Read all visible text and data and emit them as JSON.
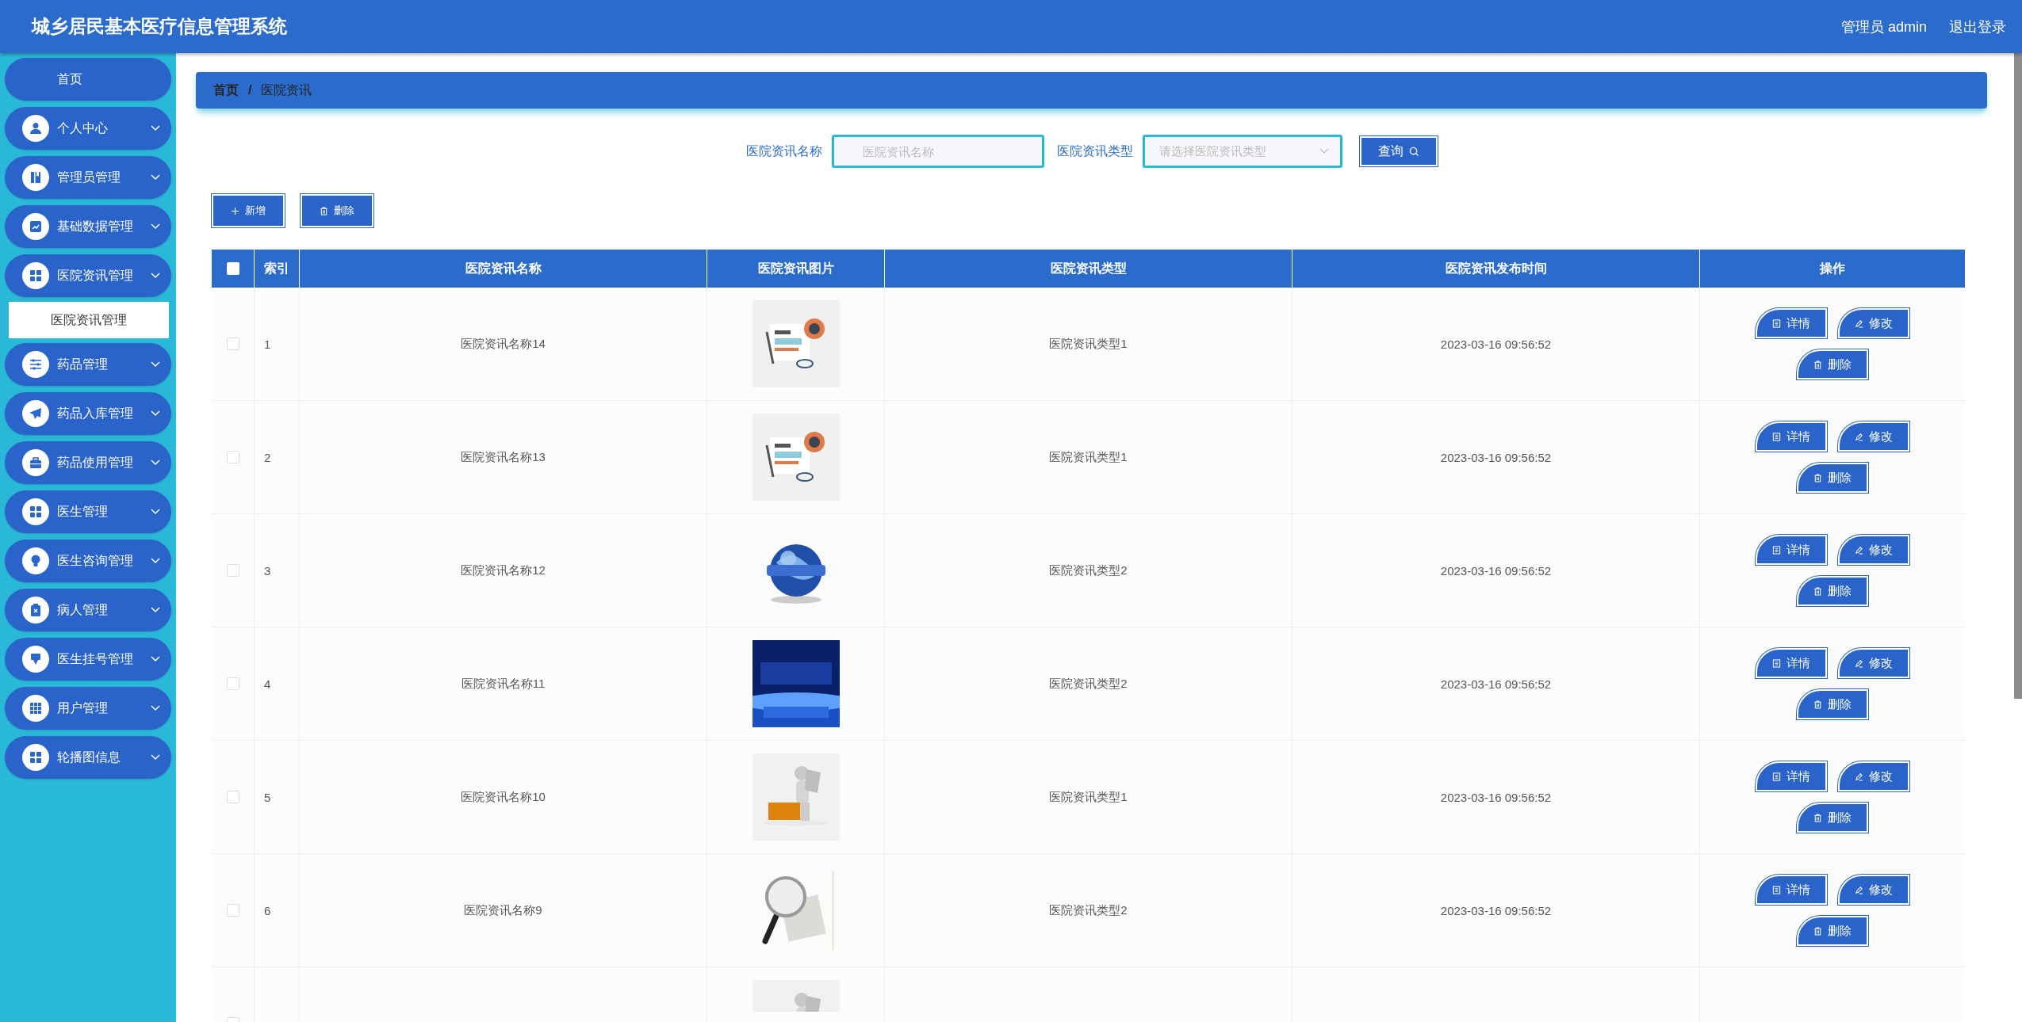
{
  "header": {
    "title": "城乡居民基本医疗信息管理系统",
    "user": "管理员 admin",
    "logout": "退出登录"
  },
  "sidebar": {
    "items": [
      {
        "kind": "link",
        "label": "首页"
      },
      {
        "kind": "menu",
        "label": "个人中心"
      },
      {
        "kind": "menu",
        "label": "管理员管理"
      },
      {
        "kind": "menu",
        "label": "基础数据管理"
      },
      {
        "kind": "menu",
        "label": "医院资讯管理",
        "children": [
          {
            "label": "医院资讯管理",
            "selected": true
          }
        ]
      },
      {
        "kind": "menu",
        "label": "药品管理"
      },
      {
        "kind": "menu",
        "label": "药品入库管理"
      },
      {
        "kind": "menu",
        "label": "药品使用管理"
      },
      {
        "kind": "menu",
        "label": "医生管理"
      },
      {
        "kind": "menu",
        "label": "医生咨询管理"
      },
      {
        "kind": "menu",
        "label": "病人管理"
      },
      {
        "kind": "menu",
        "label": "医生挂号管理"
      },
      {
        "kind": "menu",
        "label": "用户管理"
      },
      {
        "kind": "menu",
        "label": "轮播图信息"
      }
    ]
  },
  "breadcrumb": {
    "items": [
      "首页",
      "医院资讯"
    ],
    "separator": "/"
  },
  "search": {
    "fields": [
      {
        "kind": "input",
        "label": "医院资讯名称",
        "placeholder": "医院资讯名称"
      },
      {
        "kind": "select",
        "label": "医院资讯类型",
        "placeholder": "请选择医院资讯类型"
      }
    ],
    "button": "查询"
  },
  "toolbar": [
    {
      "kind": "add",
      "label": "新增"
    },
    {
      "kind": "delete",
      "label": "删除"
    }
  ],
  "table": {
    "select_all_checked": false,
    "columns": [
      "索引",
      "医院资讯名称",
      "医院资讯图片",
      "医院资讯类型",
      "医院资讯发布时间",
      "操作"
    ],
    "rows": [
      {
        "checked": false,
        "index": "1",
        "name": "医院资讯名称14",
        "type": "医院资讯类型1",
        "time": "2023-03-16 09:56:52",
        "actions": [
          {
            "kind": "detail",
            "label": "详情"
          },
          {
            "kind": "edit",
            "label": "修改"
          },
          {
            "kind": "delete",
            "label": "删除"
          }
        ]
      },
      {
        "checked": false,
        "index": "2",
        "name": "医院资讯名称13",
        "type": "医院资讯类型1",
        "time": "2023-03-16 09:56:52",
        "actions": [
          {
            "kind": "detail",
            "label": "详情"
          },
          {
            "kind": "edit",
            "label": "修改"
          },
          {
            "kind": "delete",
            "label": "删除"
          }
        ]
      },
      {
        "checked": false,
        "index": "3",
        "name": "医院资讯名称12",
        "type": "医院资讯类型2",
        "time": "2023-03-16 09:56:52",
        "actions": [
          {
            "kind": "detail",
            "label": "详情"
          },
          {
            "kind": "edit",
            "label": "修改"
          },
          {
            "kind": "delete",
            "label": "删除"
          }
        ]
      },
      {
        "checked": false,
        "index": "4",
        "name": "医院资讯名称11",
        "type": "医院资讯类型2",
        "time": "2023-03-16 09:56:52",
        "actions": [
          {
            "kind": "detail",
            "label": "详情"
          },
          {
            "kind": "edit",
            "label": "修改"
          },
          {
            "kind": "delete",
            "label": "删除"
          }
        ]
      },
      {
        "checked": false,
        "index": "5",
        "name": "医院资讯名称10",
        "type": "医院资讯类型1",
        "time": "2023-03-16 09:56:52",
        "actions": [
          {
            "kind": "detail",
            "label": "详情"
          },
          {
            "kind": "edit",
            "label": "修改"
          },
          {
            "kind": "delete",
            "label": "删除"
          }
        ]
      },
      {
        "checked": false,
        "index": "6",
        "name": "医院资讯名称9",
        "type": "医院资讯类型2",
        "time": "2023-03-16 09:56:52",
        "actions": [
          {
            "kind": "detail",
            "label": "详情"
          },
          {
            "kind": "edit",
            "label": "修改"
          },
          {
            "kind": "delete",
            "label": "删除"
          }
        ]
      },
      {
        "checked": false
      }
    ]
  }
}
